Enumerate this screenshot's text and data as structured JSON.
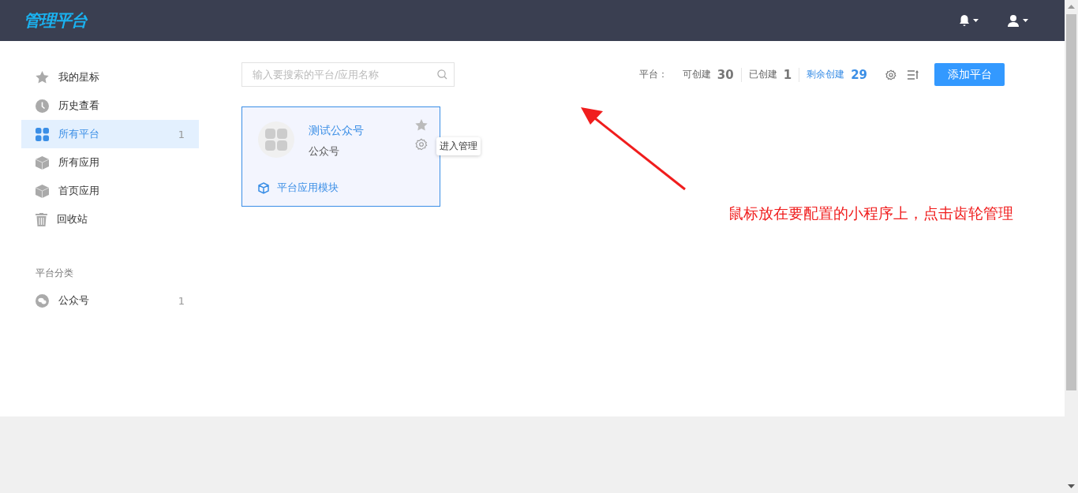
{
  "header": {
    "logo": "管理平台"
  },
  "sidebar": {
    "items": [
      {
        "label": "我的星标",
        "selected": false
      },
      {
        "label": "历史查看",
        "selected": false
      },
      {
        "label": "所有平台",
        "count": "1",
        "selected": true
      },
      {
        "label": "所有应用",
        "selected": false
      },
      {
        "label": "首页应用",
        "selected": false
      },
      {
        "label": "回收站",
        "selected": false
      }
    ],
    "section_title": "平台分类",
    "categories": [
      {
        "label": "公众号",
        "count": "1",
        "selected": false
      }
    ]
  },
  "search": {
    "placeholder": "输入要搜索的平台/应用名称"
  },
  "stats": {
    "label": "平台：",
    "items": [
      {
        "label": "可创建",
        "value": "30",
        "highlighted": false
      },
      {
        "label": "已创建",
        "value": "1",
        "highlighted": false
      },
      {
        "label": "剩余创建",
        "value": "29",
        "highlighted": true
      }
    ]
  },
  "add_button": "添加平台",
  "cards": [
    {
      "title": "测试公众号",
      "type": "公众号",
      "module_link": "平台应用模块",
      "tooltip": "进入管理",
      "hovered": true
    }
  ],
  "annotation": "鼠标放在要配置的小程序上，点击齿轮管理"
}
